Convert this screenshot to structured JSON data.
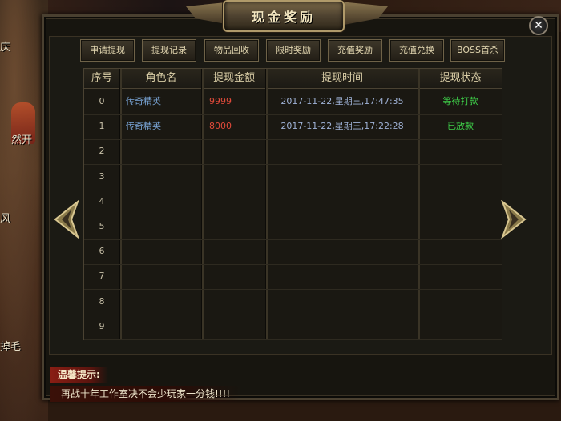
{
  "title": "现金奖励",
  "tabs": [
    "申请提现",
    "提现记录",
    "物品回收",
    "限时奖励",
    "充值奖励",
    "充值兑换",
    "BOSS首杀"
  ],
  "table": {
    "headers": [
      "序号",
      "角色名",
      "提现金额",
      "提现时间",
      "提现状态"
    ],
    "rows": [
      {
        "index": "0",
        "name": "传奇精英",
        "amount": "9999",
        "time": "2017-11-22,星期三,17:47:35",
        "status": "等待打款"
      },
      {
        "index": "1",
        "name": "传奇精英",
        "amount": "8000",
        "time": "2017-11-22,星期三,17:22:28",
        "status": "已放款"
      },
      {
        "index": "2",
        "name": "",
        "amount": "",
        "time": "",
        "status": ""
      },
      {
        "index": "3",
        "name": "",
        "amount": "",
        "time": "",
        "status": ""
      },
      {
        "index": "4",
        "name": "",
        "amount": "",
        "time": "",
        "status": ""
      },
      {
        "index": "5",
        "name": "",
        "amount": "",
        "time": "",
        "status": ""
      },
      {
        "index": "6",
        "name": "",
        "amount": "",
        "time": "",
        "status": ""
      },
      {
        "index": "7",
        "name": "",
        "amount": "",
        "time": "",
        "status": ""
      },
      {
        "index": "8",
        "name": "",
        "amount": "",
        "time": "",
        "status": ""
      },
      {
        "index": "9",
        "name": "",
        "amount": "",
        "time": "",
        "status": ""
      }
    ]
  },
  "tip": {
    "label": "温馨提示:",
    "text": "再战十年工作室决不会少玩家一分钱!!!!"
  },
  "background_text": [
    "庆",
    "然开",
    "风",
    "掉毛"
  ],
  "colors": {
    "name": "#7aa6d8",
    "amount": "#e04a3a",
    "time": "#9fb2d6",
    "status_pending": "#3fd24a",
    "status_paid": "#3fd24a"
  }
}
